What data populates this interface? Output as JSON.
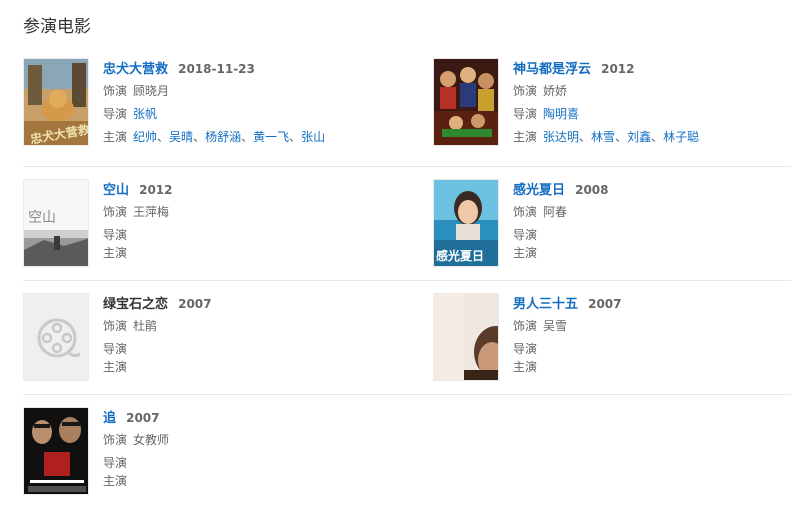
{
  "section": {
    "title": "参演电影"
  },
  "labels": {
    "role": "饰演",
    "director": "导演",
    "cast": "主演"
  },
  "movies": [
    {
      "title": "忠犬大营救",
      "date": "2018-11-23",
      "role": "顾晓月",
      "director": "张帆",
      "cast": [
        "纪帅",
        "吴晴",
        "杨舒涵",
        "黄一飞",
        "张山"
      ]
    },
    {
      "title": "神马都是浮云",
      "date": "2012",
      "role": "娇娇",
      "director": "陶明喜",
      "cast": [
        "张达明",
        "林雪",
        "刘鑫",
        "林子聪"
      ]
    },
    {
      "title": "空山",
      "date": "2012",
      "role": "王萍梅",
      "director": "",
      "cast": []
    },
    {
      "title": "感光夏日",
      "date": "2008",
      "role": "阿春",
      "director": "",
      "cast": []
    },
    {
      "title": "绿宝石之恋",
      "date": "2007",
      "role": "杜鹃",
      "director": "",
      "cast": []
    },
    {
      "title": "男人三十五",
      "date": "2007",
      "role": "吴雪",
      "director": "",
      "cast": []
    },
    {
      "title": "追",
      "date": "2007",
      "role": "女教师",
      "director": "",
      "cast": []
    }
  ],
  "poster_text": {
    "m0": "忠犬大营救",
    "m2": "空山",
    "m3": "感光夏日"
  },
  "icons": {
    "placeholder": "film-reel-icon"
  }
}
